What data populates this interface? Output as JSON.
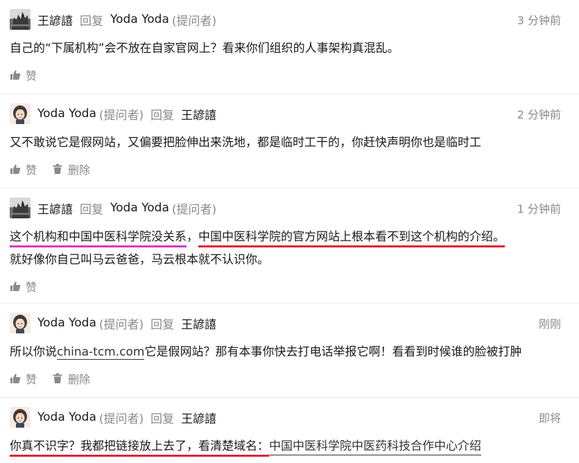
{
  "comments": [
    {
      "author": "王諺譆",
      "role": "",
      "reply_label": "回复",
      "target": "Yoda Yoda",
      "target_role": "(提问者)",
      "time": "3 分钟前",
      "lines": [
        "自己的“下属机构”会不放在自家官网上？看来你们组织的人事架构真混乱。"
      ],
      "like_label": "赞"
    },
    {
      "author": "Yoda Yoda",
      "role": "(提问者)",
      "reply_label": "回复",
      "target": "王諺譆",
      "target_role": "",
      "time": "2 分钟前",
      "lines": [
        "又不敢说它是假网站，又偏要把脸伸出来洗地，都是临时工干的，你赶快声明你也是临时工"
      ],
      "like_label": "赞",
      "delete_label": "删除"
    },
    {
      "author": "王諺譆",
      "role": "",
      "reply_label": "回复",
      "target": "Yoda Yoda",
      "target_role": "(提问者)",
      "time": "1 分钟前",
      "seg1": "这个机构和中国中医科学院没关系",
      "seg2": "，",
      "seg3": "中国中医科学院的官方网站上根本看不到这个机构的介绍。",
      "line2": "就好像你自己叫马云爸爸，马云根本就不认识你。",
      "like_label": "赞"
    },
    {
      "author": "Yoda Yoda",
      "role": "(提问者)",
      "reply_label": "回复",
      "target": "王諺譆",
      "target_role": "",
      "time": "刚刚",
      "pre": "所以你说",
      "link": "china-tcm.com",
      "post": "它是假网站？那有本事你快去打电话举报它啊！看看到时候谁的脸被打肿",
      "like_label": "赞",
      "delete_label": "删除"
    },
    {
      "author": "Yoda Yoda",
      "role": "(提问者)",
      "reply_label": "回复",
      "target": "王諺譆",
      "target_role": "",
      "time": "即将",
      "seg1": "你真不识字？我都把链接放上去了，看清楚域名：",
      "seg2": "中国中医科学院中医药科技合作中心介绍"
    }
  ],
  "colors": {
    "highlight_pink": "#d63ac0",
    "highlight_red": "#e0203a",
    "meta_gray": "#8a8a8a"
  }
}
